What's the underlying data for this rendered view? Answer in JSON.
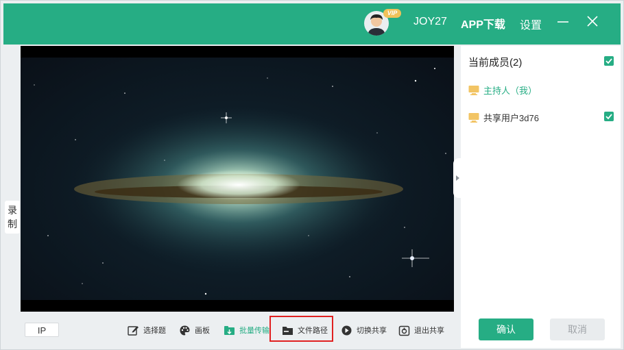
{
  "titlebar": {
    "vip_badge": "VIP",
    "username": "JOY27",
    "app_download": "APP下载",
    "settings": "设置"
  },
  "side_tab": {
    "record_line1": "录",
    "record_line2": "制"
  },
  "toolbar": {
    "ip_label": "IP",
    "items": [
      {
        "label": "选择题",
        "icon": "edit-icon"
      },
      {
        "label": "画板",
        "icon": "palette-icon"
      },
      {
        "label": "批量传输",
        "icon": "batch-transfer-icon"
      },
      {
        "label": "文件路径",
        "icon": "folder-icon"
      },
      {
        "label": "切换共享",
        "icon": "switch-share-icon"
      },
      {
        "label": "退出共享",
        "icon": "exit-share-icon"
      }
    ]
  },
  "panel": {
    "members_title": "当前成员(2)",
    "members": [
      {
        "label": "主持人（我）",
        "icon": "monitor-icon",
        "checked": false
      },
      {
        "label": "共享用户3d76",
        "icon": "monitor-icon",
        "checked": true
      }
    ],
    "confirm_label": "确认",
    "cancel_label": "取消"
  },
  "colors": {
    "accent": "#26ad84",
    "highlight": "#e02020"
  }
}
